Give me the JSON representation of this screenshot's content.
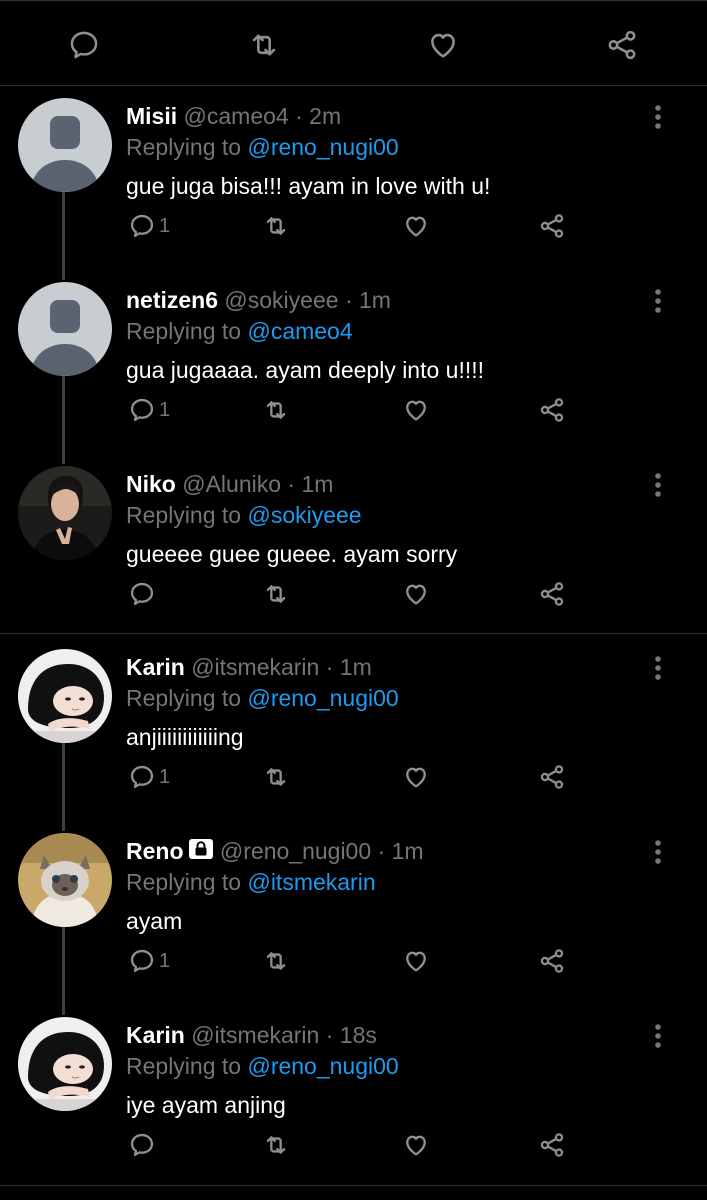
{
  "colors": {
    "background": "#000000",
    "text": "#ffffff",
    "secondary_text": "#71767b",
    "mention": "#1d9bf0",
    "divider": "#2f3336",
    "thread_line": "#3a3f44"
  },
  "top_actions": [
    {
      "icon": "reply-icon"
    },
    {
      "icon": "retweet-icon"
    },
    {
      "icon": "like-icon"
    },
    {
      "icon": "share-icon"
    }
  ],
  "tweets": [
    {
      "name": "Misii",
      "handle": "@cameo4",
      "dot": "·",
      "time": "2m",
      "replying_prefix": "Replying to",
      "replying_to": "@reno_nugi00",
      "text": "gue juga bisa!!! ayam in love with u!",
      "reply_count": "1",
      "avatar": "default-avatar"
    },
    {
      "name": "netizen6",
      "handle": "@sokiyeee",
      "dot": "·",
      "time": "1m",
      "replying_prefix": "Replying to",
      "replying_to": "@cameo4",
      "text": "gua jugaaaa. ayam deeply into u!!!!",
      "reply_count": "1",
      "avatar": "default-avatar"
    },
    {
      "name": "Niko",
      "handle": "@Aluniko",
      "dot": "·",
      "time": "1m",
      "replying_prefix": "Replying to",
      "replying_to": "@sokiyeee",
      "text": "gueeee guee gueee. ayam sorry",
      "reply_count": "",
      "avatar": "photo-avatar-man"
    },
    {
      "name": "Karin",
      "handle": "@itsmekarin",
      "dot": "·",
      "time": "1m",
      "replying_prefix": "Replying to",
      "replying_to": "@reno_nugi00",
      "text": "anjiiiiiiiiiiiing",
      "reply_count": "1",
      "avatar": "photo-avatar-woman"
    },
    {
      "name": "Reno",
      "handle": "@reno_nugi00",
      "dot": "·",
      "time": "1m",
      "replying_prefix": "Replying to",
      "replying_to": "@itsmekarin",
      "text": "ayam",
      "reply_count": "1",
      "avatar": "photo-avatar-cat",
      "protected": true
    },
    {
      "name": "Karin",
      "handle": "@itsmekarin",
      "dot": "·",
      "time": "18s",
      "replying_prefix": "Replying to",
      "replying_to": "@reno_nugi00",
      "text": "iye ayam anjing",
      "reply_count": "",
      "avatar": "photo-avatar-woman"
    }
  ]
}
